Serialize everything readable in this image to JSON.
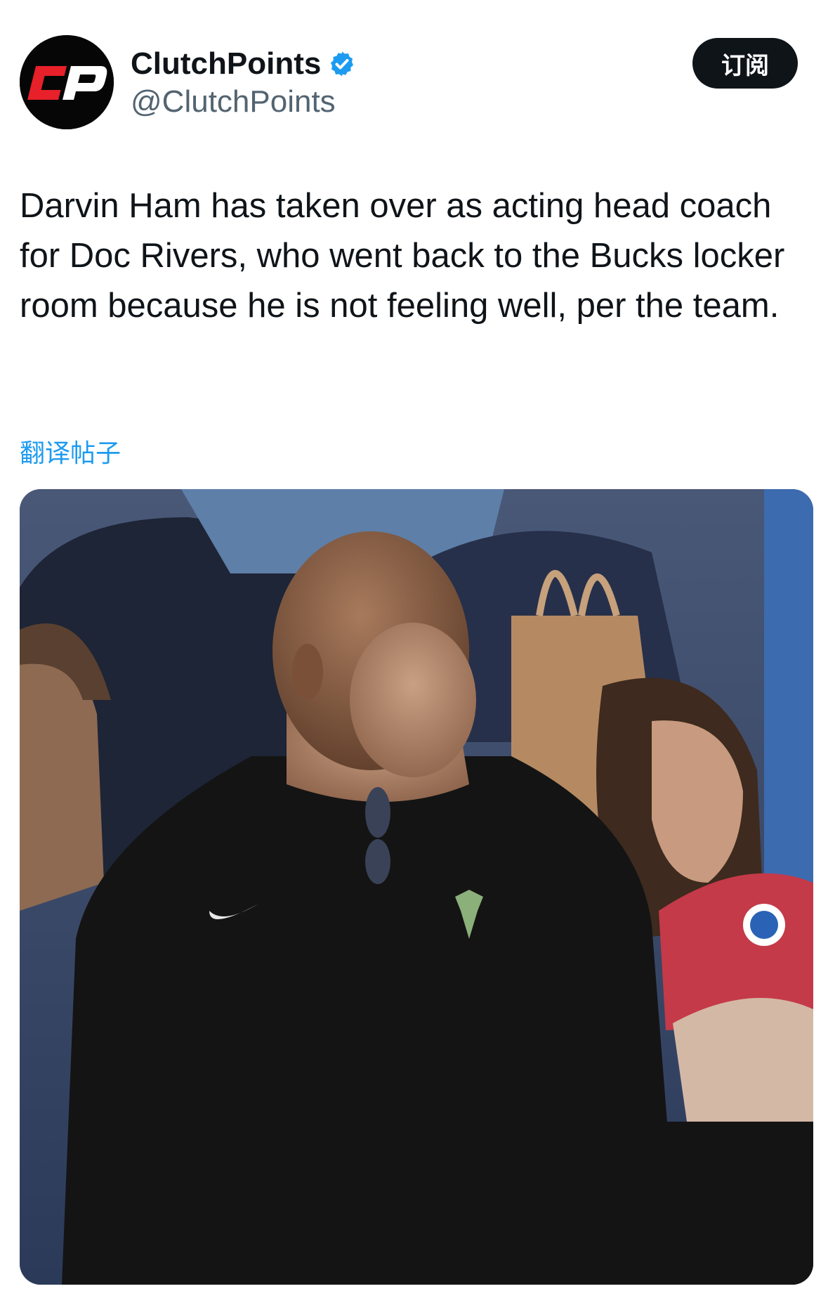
{
  "author": {
    "display_name": "ClutchPoints",
    "handle": "@ClutchPoints",
    "avatar_logo_text": "CP",
    "verified": true
  },
  "subscribe_button": {
    "label": "订阅"
  },
  "tweet": {
    "text": "Darvin Ham has taken over as acting head coach for Doc Rivers, who went back to the Bucks locker room because he is not feeling well, per the team.",
    "translate_label": "翻译帖子"
  },
  "media": {
    "icon": "photo"
  },
  "colors": {
    "accent": "#1d9bf0",
    "text_primary": "#0f1419",
    "text_secondary": "#536471",
    "button_bg": "#0f1419",
    "logo_red": "#e8202a"
  }
}
